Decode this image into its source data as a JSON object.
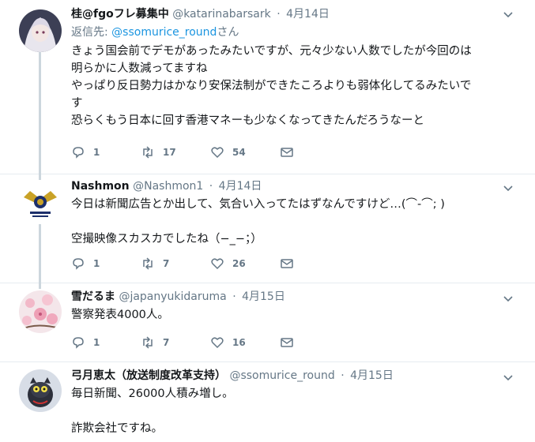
{
  "tweets": [
    {
      "name": "桂@fgoフレ募集中",
      "handle": "@katarinabarsark",
      "date": "4月14日",
      "reply_prefix": "返信先:",
      "reply_mention": "@ssomurice_round",
      "reply_suffix": "さん",
      "text": "きょう国会前でデモがあったみたいですが、元々少ない人数でしたが今回のは\n明らかに人数減ってますね\nやっぱり反日勢力はかなり安保法制ができたころよりも弱体化してるみたいで\nす\n恐らくもう日本に回す香港マネーも少なくなってきたんだろうなーと",
      "replies": "1",
      "retweets": "17",
      "likes": "54"
    },
    {
      "name": "Nashmon",
      "handle": "@Nashmon1",
      "date": "4月14日",
      "text": "今日は新聞広告とか出して、気合い入ってたはずなんですけど…(⌒-⌒; )\n\n空撮映像スカスカでしたね（−_−；）",
      "replies": "1",
      "retweets": "7",
      "likes": "26"
    },
    {
      "name": "雪だるま",
      "handle": "@japanyukidaruma",
      "date": "4月15日",
      "text": "警察発表4000人。",
      "replies": "1",
      "retweets": "7",
      "likes": "16"
    },
    {
      "name": "弓月恵太（放送制度改革支持）",
      "handle": "@ssomurice_round",
      "date": "4月15日",
      "text": "毎日新聞、26000人積み増し。\n\n詐欺会社ですね。"
    }
  ],
  "colors": {
    "accent": "#1b95e0",
    "muted": "#657786",
    "divider": "#e6ecf0",
    "thread_line": "#ccd6dd"
  }
}
